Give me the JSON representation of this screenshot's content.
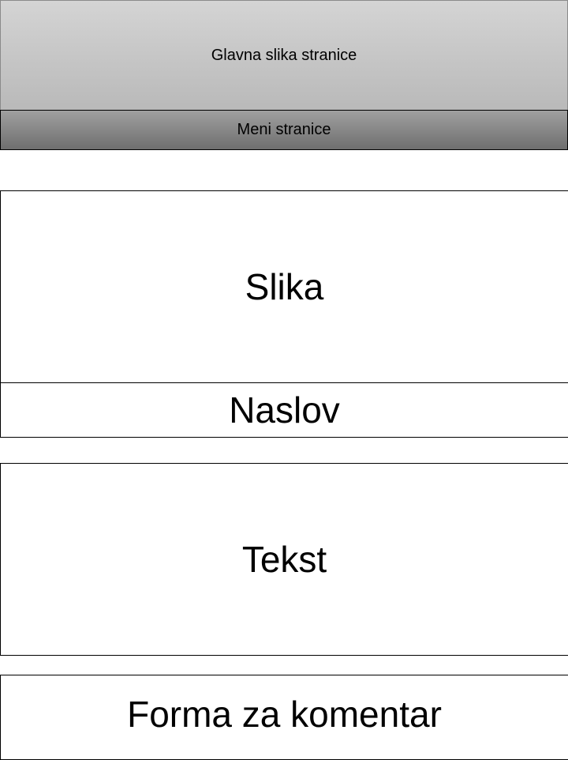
{
  "header": {
    "main_image_label": "Glavna slika stranice",
    "menu_label": "Meni stranice"
  },
  "content": {
    "image_label": "Slika",
    "title_label": "Naslov",
    "text_label": "Tekst",
    "comment_form_label": "Forma za komentar"
  }
}
